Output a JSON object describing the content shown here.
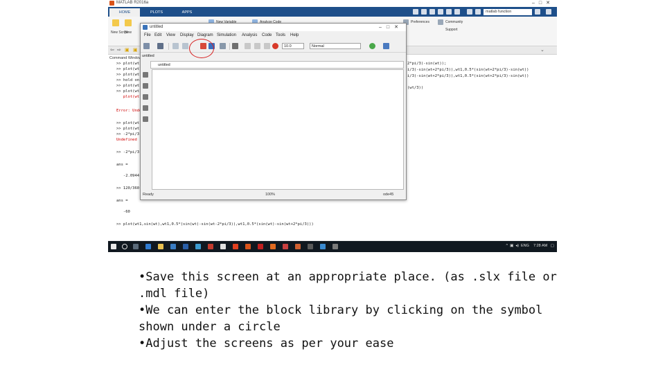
{
  "matlab": {
    "title": "MATLAB R2016a",
    "tabs": [
      "HOME",
      "PLOTS",
      "APPS"
    ],
    "search_value": "matlab function",
    "ribbon": {
      "new_label": "New",
      "new_script_label": "New Script",
      "new_variable_label": "New Variable",
      "analyze_code_label": "Analyze Code",
      "preferences_label": "Preferences",
      "community_label": "Community",
      "support_label": "Support"
    },
    "command_window_label": "Command Window",
    "command_lines": [
      ">> plot(wt1,",
      ">> plot(wt1,",
      ">> plot(wt1,",
      ">> hold on",
      ">> plot(wt1,",
      ">> plot(wt1,",
      "   plot(wt1,",
      "Error: Undefined",
      ">> plot(wt1,",
      ">> plot(wt1,",
      ">> -2*pi/3",
      "Undefined",
      ">> -2*pi/3",
      "ans =",
      "   -2.0944",
      ">> 120/360",
      "ans =",
      "   -60",
      ">> plot(wt1,sin(wt),wt1,0.5*(sin(wt)-sin(wt-2*pi/3)),wt1,0.5*(sin(wt)-sin(wt+2*pi/3)))"
    ],
    "right_fragments": [
      "2*pi/3)-sin(wt));",
      "i/3)-sin(wt+2*pi/3)),wt1,0.5*(sin(wt+2*pi/3)-sin(wt))",
      "i/3)-sin(wt+2*pi/3)),wt1,0.5*(sin(wt+2*pi/3)-sin(wt))",
      "(wt/3))"
    ],
    "tray": {
      "lang": "ENG",
      "time": "7:28 AM"
    }
  },
  "simulink": {
    "title": "untitled",
    "menu": [
      "File",
      "Edit",
      "View",
      "Display",
      "Diagram",
      "Simulation",
      "Analysis",
      "Code",
      "Tools",
      "Help"
    ],
    "stop_time": "10.0",
    "mode": "Normal",
    "tab_label": "untitled",
    "breadcrumb": "untitled",
    "status": {
      "left": "Ready",
      "zoom": "100%",
      "solver": "ode45"
    }
  },
  "bullets": [
    "•Save this screen at an appropriate place. (as .slx file or .mdl file)",
    "•We can enter the block library by clicking on the symbol shown under a circle",
    "•Adjust the screens as per your ease"
  ],
  "colors": {
    "ribbon_blue": "#1e4f8a",
    "annotation_red": "#d62020",
    "error_red": "#d00000"
  }
}
